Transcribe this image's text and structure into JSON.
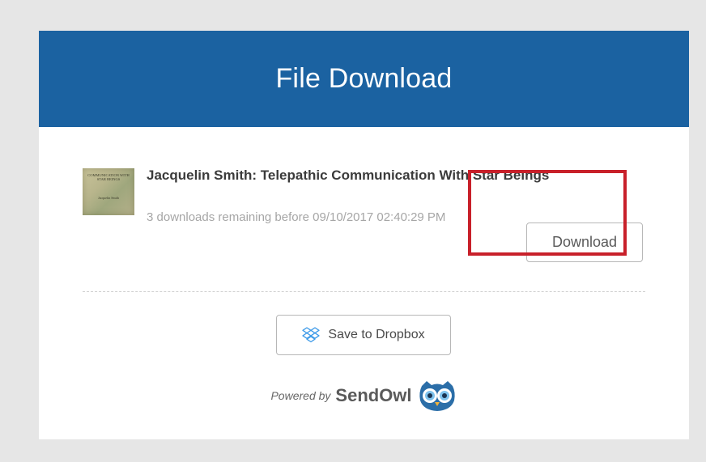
{
  "header": {
    "title": "File Download"
  },
  "item": {
    "cover": {
      "title_text": "Communication with Star Beings",
      "author_text": "Jacquelin Smith"
    },
    "title": "Jacquelin Smith: Telepathic Communication With Star Beings",
    "meta": "3 downloads remaining before 09/10/2017 02:40:29 PM",
    "download_label": "Download"
  },
  "dropbox": {
    "label": "Save to Dropbox",
    "icon": "dropbox-icon"
  },
  "footer": {
    "powered_by": "Powered by",
    "brand": "SendOwl",
    "icon": "owl-logo-icon"
  },
  "colors": {
    "header_bg": "#1b62a1",
    "highlight": "#c8202a",
    "dropbox_blue": "#3d9ae8",
    "owl_blue": "#2b6ea8"
  }
}
